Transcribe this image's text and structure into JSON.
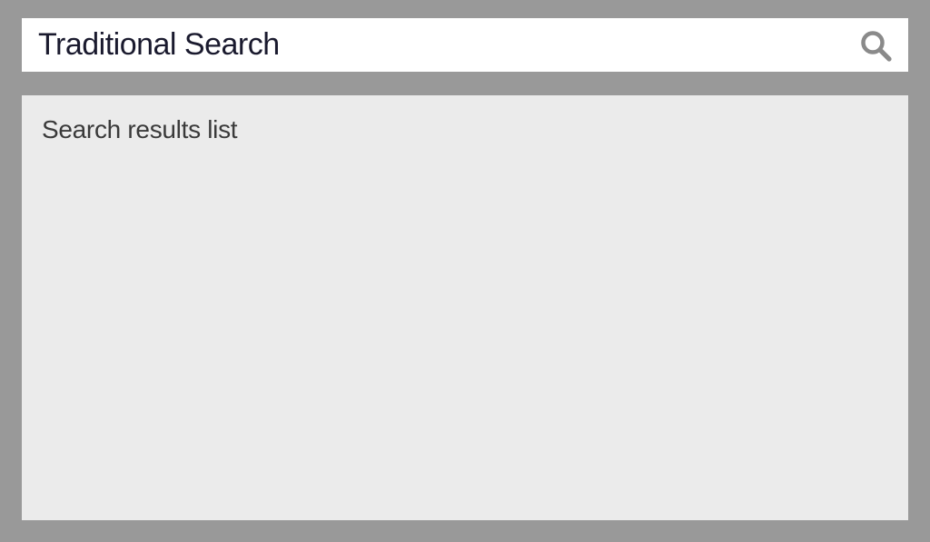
{
  "search": {
    "title": "Traditional Search",
    "icons": {
      "search": "search-icon"
    }
  },
  "results": {
    "label": "Search results list"
  },
  "colors": {
    "background": "#999999",
    "searchBar": "#ffffff",
    "resultsPanel": "#ebebeb",
    "titleText": "#1a1a2e",
    "labelText": "#3a3a3a",
    "iconColor": "#8a8a8a"
  }
}
